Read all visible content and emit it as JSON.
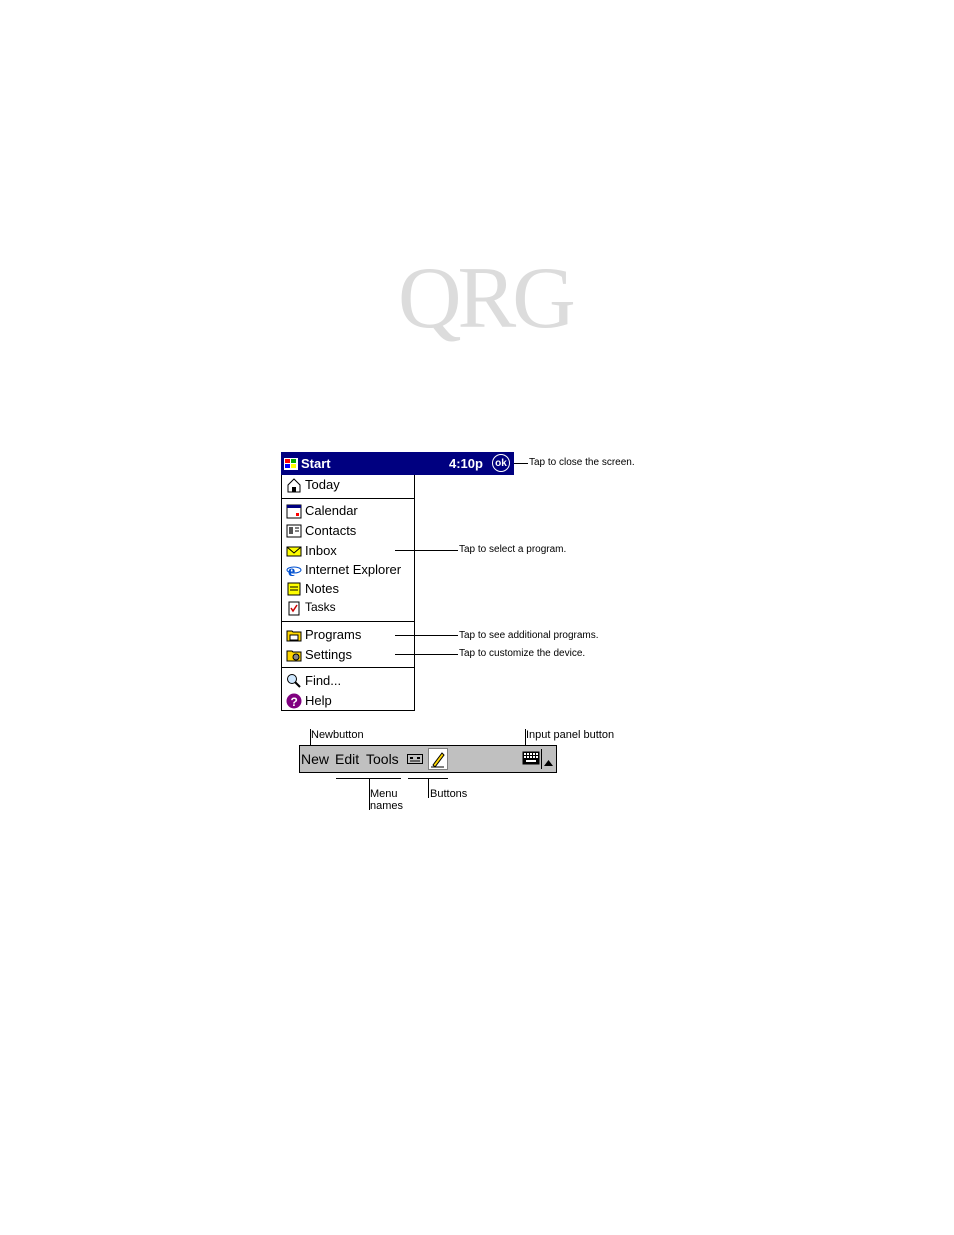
{
  "watermark": "QRG",
  "start_bar": {
    "title": "Start",
    "time": "4:10p",
    "ok_label": "ok"
  },
  "menu": {
    "items": [
      {
        "label": "Today",
        "icon": "today-icon"
      },
      {
        "label": "Calendar",
        "icon": "calendar-icon"
      },
      {
        "label": "Contacts",
        "icon": "contacts-icon"
      },
      {
        "label": "Inbox",
        "icon": "inbox-icon"
      },
      {
        "label": "Internet Explorer",
        "icon": "internet-explorer-icon"
      },
      {
        "label": "Notes",
        "icon": "notes-icon"
      },
      {
        "label": "Tasks",
        "icon": "tasks-icon"
      },
      {
        "label": "Programs",
        "icon": "programs-icon"
      },
      {
        "label": "Settings",
        "icon": "settings-icon"
      },
      {
        "label": "Find...",
        "icon": "find-icon"
      },
      {
        "label": "Help",
        "icon": "help-icon"
      }
    ]
  },
  "callouts": {
    "close": "Tap to close the screen.",
    "select_program": "Tap to select a program.",
    "additional_programs": "Tap to see additional programs.",
    "customize": "Tap to customize the device."
  },
  "toolbar": {
    "menus": [
      "New",
      "Edit",
      "Tools"
    ],
    "labels": {
      "new_button": "Newbutton",
      "input_panel": "Input panel button",
      "menu_names_1": "Menu",
      "menu_names_2": "names",
      "buttons": "Buttons"
    }
  },
  "colors": {
    "title_bar": "#000080",
    "toolbar": "#c0c0c0",
    "watermark": "#dcdcdc"
  }
}
